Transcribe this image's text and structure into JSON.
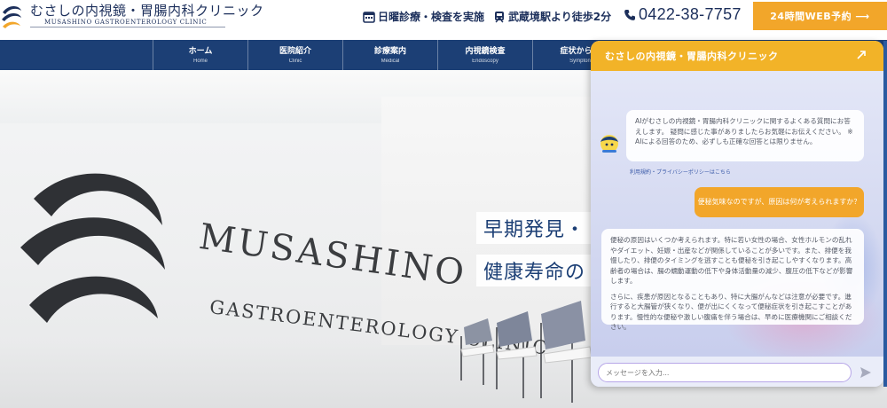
{
  "header": {
    "logo_title": "むさしの内視鏡・胃腸内科クリニック",
    "logo_sub": "MUSASHINO GASTROENTEROLOGY CLINIC",
    "sunday": "日曜診療・検査を実施",
    "station": "武蔵境駅より徒歩2分",
    "phone": "0422-38-7757",
    "reserve": "24時間WEB予約 ⟶"
  },
  "nav": [
    {
      "jp": "ホーム",
      "en": "Home"
    },
    {
      "jp": "医院紹介",
      "en": "Clinic"
    },
    {
      "jp": "診療案内",
      "en": "Medical"
    },
    {
      "jp": "内視鏡検査",
      "en": "Endoscopy"
    },
    {
      "jp": "症状から探",
      "en": "Sympton"
    }
  ],
  "hero": {
    "wall_text1": "MUSASHINO",
    "wall_text2": "GASTROENTEROLOGY CLINIC",
    "catch1": "早期発見・",
    "catch2": "健康寿命の"
  },
  "chat": {
    "title": "むさしの内視鏡・胃腸内科クリニック",
    "intro": "AIがむさしの内視鏡・胃腸内科クリニックに関するよくある質問にお答えします。 疑問に感じた事がありましたらお気軽にお伝えください。 ※ AIによる回答のため、必ずしも正確な回答とは限りません。",
    "policy_link": "利用規約・プライバシーポリシーはこちら",
    "user_message": "便秘気味なのですが、原因は何が考えられますか？",
    "answer_p1": "便秘の原因はいくつか考えられます。特に若い女性の場合、女性ホルモンの乱れやダイエット、妊娠・出産などが関係していることが多いです。また、排便を我慢したり、排便のタイミングを逃すことも便秘を引き起こしやすくなります。高齢者の場合は、腸の蠕動運動の低下や身体活動量の減少、腹圧の低下などが影響します。",
    "answer_p2": "さらに、疾患が原因となることもあり、特に大腸がんなどは注意が必要です。進行すると大腸管が狭くなり、便が出にくくなって便秘症状を引き起こすことがあります。慢性的な便秘や激しい腹痛を伴う場合は、早めに医療機関にご相談ください。",
    "input_placeholder": "メッセージを入力..."
  },
  "colors": {
    "navy": "#1c3f75",
    "accent": "#f2a62a",
    "chat_bg": "#d4d9f1"
  }
}
